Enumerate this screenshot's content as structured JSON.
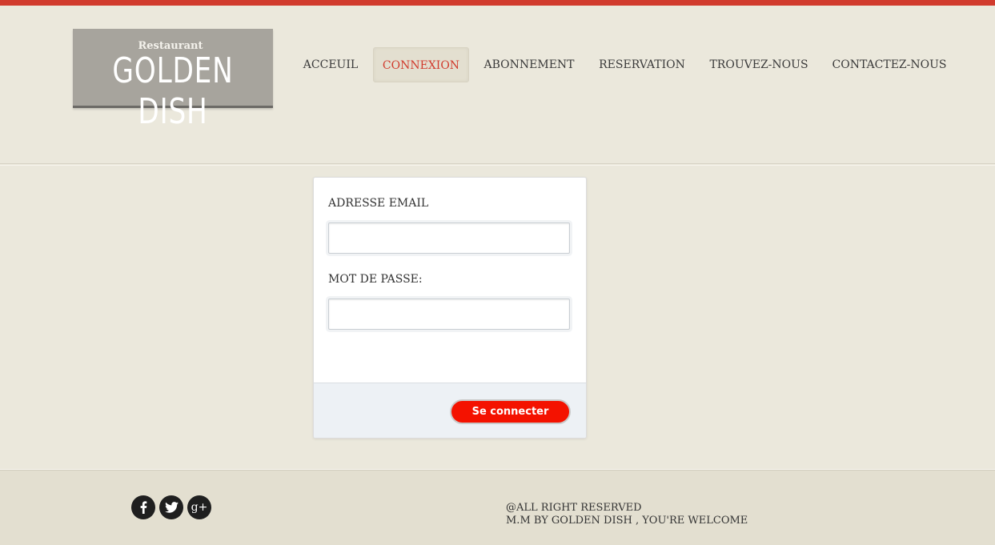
{
  "header": {
    "logo_small": "Restaurant",
    "logo_big": "GOLDEN DISH",
    "nav": [
      {
        "label": "ACCEUIL",
        "active": false
      },
      {
        "label": "CONNEXION",
        "active": true
      },
      {
        "label": "ABONNEMENT",
        "active": false
      },
      {
        "label": "RESERVATION",
        "active": false
      },
      {
        "label": "TROUVEZ-NOUS",
        "active": false
      },
      {
        "label": "CONTACTEZ-NOUS",
        "active": false
      }
    ]
  },
  "login": {
    "email_label": "ADRESSE EMAIL",
    "email_value": "",
    "password_label": "MOT DE PASSE:",
    "password_value": "",
    "submit_label": "Se connecter"
  },
  "footer": {
    "social": [
      {
        "icon": "facebook-icon",
        "glyph": "f"
      },
      {
        "icon": "twitter-icon",
        "glyph": "t"
      },
      {
        "icon": "google-plus-icon",
        "glyph": "g+"
      }
    ],
    "line1": "@ALL RIGHT RESERVED",
    "line2": "M.M BY GOLDEN DISH , YOU'RE WELCOME"
  },
  "colors": {
    "accent": "#d13b2d",
    "button": "#f41200",
    "background": "#ebe8dc"
  }
}
